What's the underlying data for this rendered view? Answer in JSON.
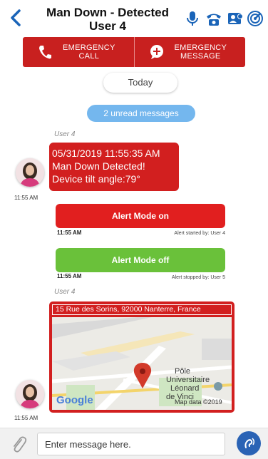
{
  "header": {
    "title_line1": "Man Down - Detected",
    "title_line2": "User 4"
  },
  "emergency": {
    "call_line1": "EMERGENCY",
    "call_line2": "CALL",
    "message_line1": "EMERGENCY",
    "message_line2": "MESSAGE"
  },
  "date_divider": "Today",
  "unread_banner": "2 unread messages",
  "messages": [
    {
      "sender": "User 4",
      "time": "11:55 AM",
      "lines": [
        "05/31/2019 11:55:35 AM",
        "Man Down Detected!",
        "Device tilt angle:79°"
      ]
    }
  ],
  "alerts": [
    {
      "label": "Alert Mode on",
      "time": "11:55 AM",
      "note": "Alert started by: User 4",
      "color": "#e11f1f"
    },
    {
      "label": "Alert Mode off",
      "time": "11:55 AM",
      "note": "Alert stopped by: User 5",
      "color": "#6ac13a"
    }
  ],
  "location_message": {
    "sender": "User 4",
    "time": "11:55 AM",
    "address": "15 Rue des Sorins, 92000 Nanterre, France",
    "map_poi_line1": "Pôle",
    "map_poi_line2": "Universitaire",
    "map_poi_line3": "Léonard",
    "map_poi_line4": "de Vinci",
    "map_brand": "Google",
    "map_attribution": "Map data ©2019"
  },
  "composer": {
    "placeholder": "Enter message here."
  },
  "colors": {
    "accent_blue": "#1a64b8",
    "emergency_red": "#c8201f",
    "alert_green": "#6ac13a",
    "unread_blue": "#74b7ee"
  },
  "icons": [
    "back-chevron-icon",
    "microphone-icon",
    "conference-phone-icon",
    "contact-card-icon",
    "radar-icon",
    "phone-icon",
    "message-plus-icon",
    "map-pin-icon",
    "paperclip-icon",
    "voice-icon"
  ]
}
